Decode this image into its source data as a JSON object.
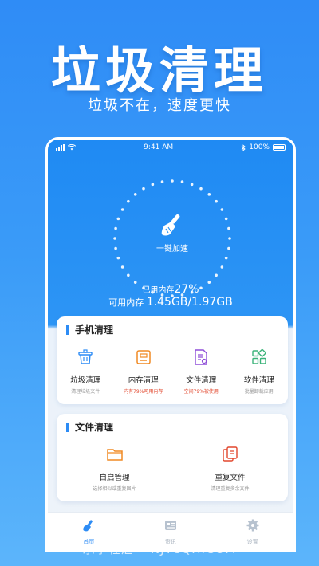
{
  "hero": {
    "title": "垃圾清理",
    "subtitle": "垃圾不在，速度更快"
  },
  "status_bar": {
    "time": "9:41 AM",
    "battery": "100%"
  },
  "booster": {
    "label": "一键加速"
  },
  "memory": {
    "usage_label": "已用内存",
    "usage_percent": "27%",
    "detail_label": "可用内存",
    "detail_value": "1.45GB/1.97GB"
  },
  "phone_clean": {
    "title": "手机清理",
    "items": [
      {
        "label": "垃圾清理",
        "desc": "清理垃圾文件",
        "icon": "trash-basket-icon"
      },
      {
        "label": "内存清理",
        "desc": "内有79%可用内存",
        "icon": "memory-chip-icon",
        "hot": true
      },
      {
        "label": "文件清理",
        "desc": "空间79%被使用",
        "icon": "file-doc-icon",
        "hot": true
      },
      {
        "label": "软件清理",
        "desc": "批量卸载应用",
        "icon": "apps-grid-icon"
      }
    ]
  },
  "file_clean": {
    "title": "文件清理",
    "items": [
      {
        "label": "自启管理",
        "desc": "选择相似或重复图片",
        "icon": "folder-icon"
      },
      {
        "label": "重复文件",
        "desc": "清理重复多余文件",
        "icon": "duplicate-files-icon"
      }
    ]
  },
  "tabs": [
    {
      "label": "首页",
      "icon": "broom-icon",
      "active": true
    },
    {
      "label": "资讯",
      "icon": "news-icon"
    },
    {
      "label": "设置",
      "icon": "settings-icon"
    }
  ],
  "watermark": "乐享轻汇 • NJYCQH.COM",
  "colors": {
    "primary": "#2d8cf5",
    "accent_orange": "#f08a24",
    "accent_red": "#e2472d",
    "accent_purple": "#8f4ed8",
    "accent_green": "#3bb37a"
  }
}
